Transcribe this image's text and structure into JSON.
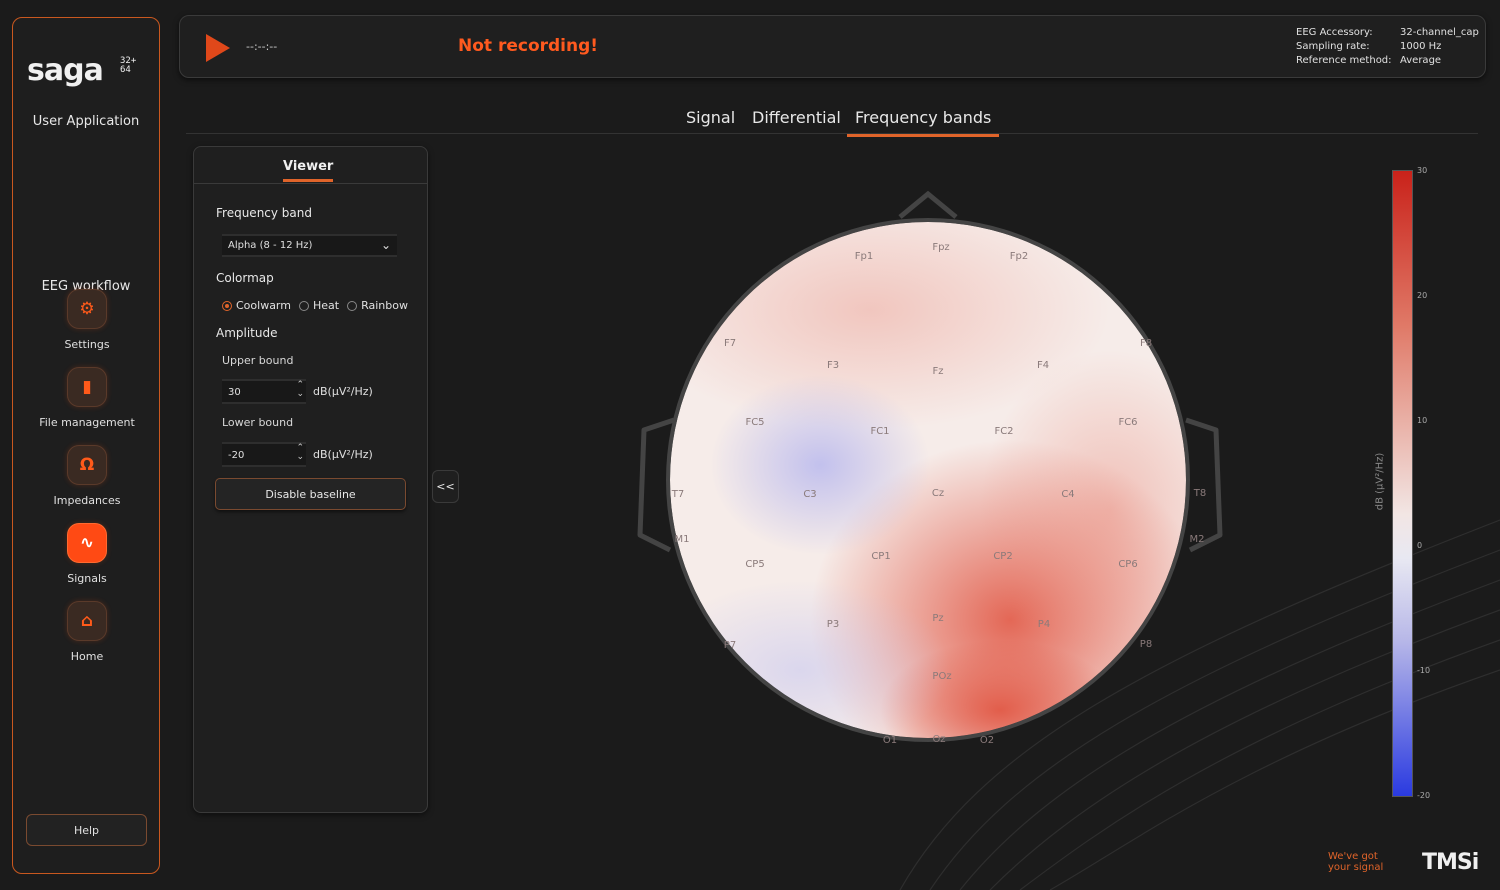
{
  "sidebar": {
    "logo_word": "saga",
    "logo_channels_top": "32+",
    "logo_channels_bottom": "64",
    "subtitle": "User Application",
    "workflow_title": "EEG workflow",
    "items": [
      {
        "label": "Settings",
        "icon": "gears-icon"
      },
      {
        "label": "File management",
        "icon": "file-icon"
      },
      {
        "label": "Impedances",
        "icon": "omega-icon"
      },
      {
        "label": "Signals",
        "icon": "pulse-icon"
      },
      {
        "label": "Home",
        "icon": "home-icon"
      }
    ],
    "active_item": "Signals",
    "help_label": "Help"
  },
  "topbar": {
    "timer": "--:--:--",
    "status": "Not recording!",
    "info": [
      {
        "key": "EEG Accessory:",
        "value": "32-channel_cap"
      },
      {
        "key": "Sampling rate:",
        "value": "1000 Hz"
      },
      {
        "key": "Reference method:",
        "value": "Average"
      }
    ]
  },
  "tabs": [
    {
      "label": "Signal",
      "active": false
    },
    {
      "label": "Differential",
      "active": false
    },
    {
      "label": "Frequency bands",
      "active": true
    }
  ],
  "panel": {
    "tab": "Viewer",
    "frequency_band_label": "Frequency band",
    "frequency_band_value": "Alpha (8 - 12 Hz)",
    "colormap_label": "Colormap",
    "colormap_options": [
      "Coolwarm",
      "Heat",
      "Rainbow"
    ],
    "colormap_selected": "Coolwarm",
    "amplitude_label": "Amplitude",
    "upper_label": "Upper bound",
    "upper_value": "30",
    "lower_label": "Lower bound",
    "lower_value": "-20",
    "unit": "dB(μV²/Hz)",
    "baseline_label": "Disable baseline",
    "collapse_label": "<<"
  },
  "topomap": {
    "electrodes": [
      "Fp1",
      "Fpz",
      "Fp2",
      "F7",
      "F3",
      "Fz",
      "F4",
      "F8",
      "FC5",
      "FC1",
      "FC2",
      "FC6",
      "T7",
      "C3",
      "Cz",
      "C4",
      "T8",
      "M1",
      "CP5",
      "CP1",
      "CP2",
      "CP6",
      "M2",
      "P7",
      "P3",
      "Pz",
      "P4",
      "P8",
      "POz",
      "O1",
      "Oz",
      "O2"
    ]
  },
  "colorbar": {
    "ticks": [
      "30",
      "20",
      "10",
      "0",
      "-10",
      "-20"
    ],
    "label": "dB (μV²/Hz)",
    "colors": {
      "high": "#c9221a",
      "mid": "#f2e6e4",
      "low": "#2a3ae0"
    }
  },
  "footer": {
    "slogan_line1": "We've got",
    "slogan_line2": "your signal",
    "brand": "TMSi"
  },
  "colors": {
    "accent": "#e0642a",
    "status": "#ff5a1f",
    "background": "#1b1b1b"
  }
}
